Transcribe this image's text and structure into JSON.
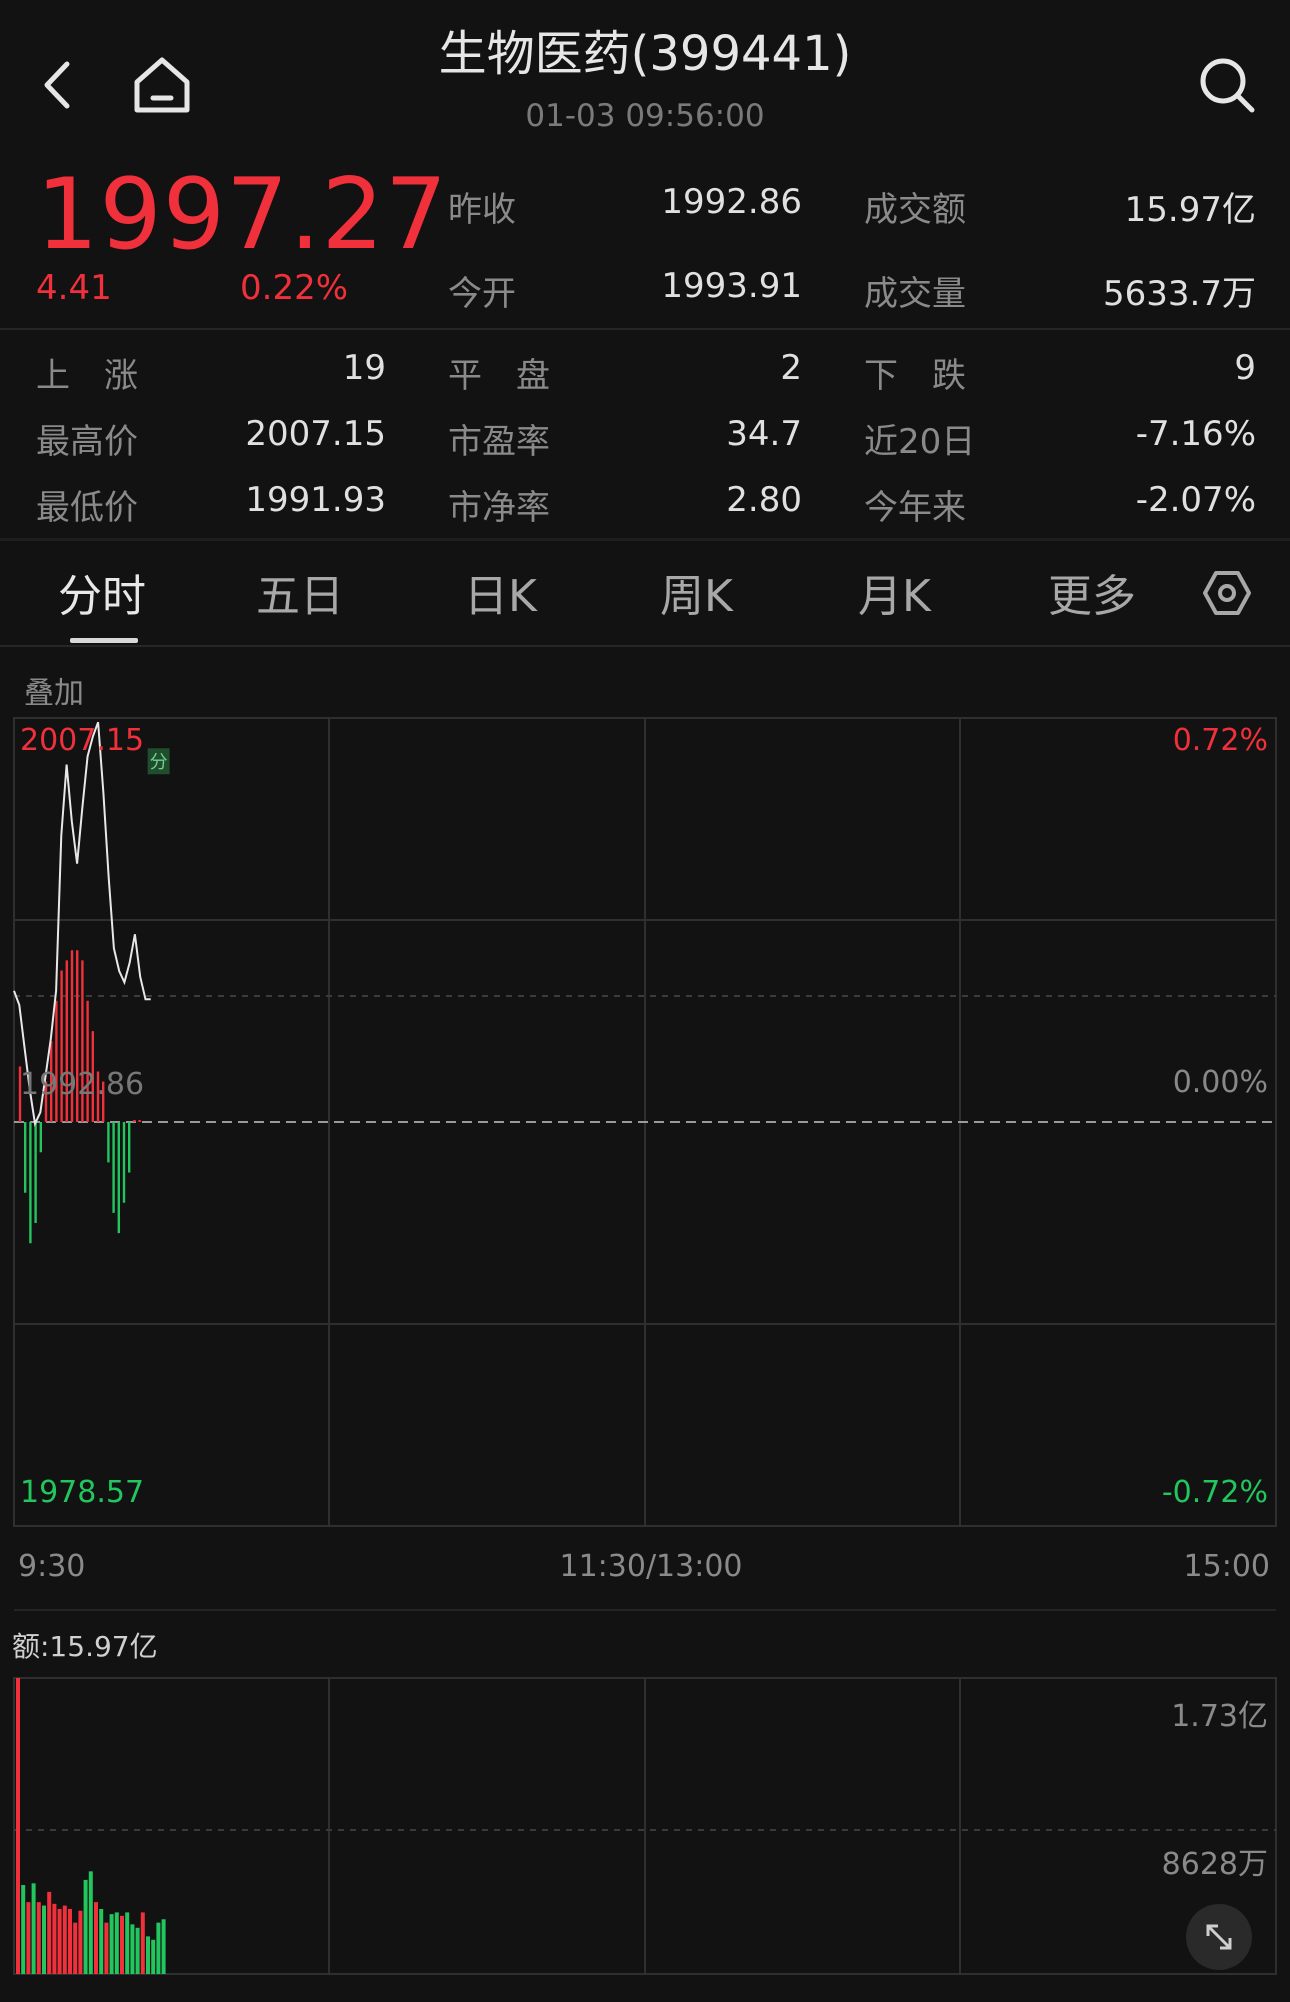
{
  "header": {
    "title": "生物医药(399441)",
    "time": "01-03 09:56:00"
  },
  "quote": {
    "price": "1997.27",
    "change": "4.41",
    "change_pct": "0.22%",
    "prev_close_label": "昨收",
    "prev_close": "1992.86",
    "amount_label": "成交额",
    "amount": "15.97亿",
    "open_label": "今开",
    "open": "1993.91",
    "volume_label": "成交量",
    "volume": "5633.7万"
  },
  "stats": {
    "up_label": "上　涨",
    "up": "19",
    "flat_label": "平　盘",
    "flat": "2",
    "down_label": "下　跌",
    "down": "9",
    "high_label": "最高价",
    "high": "2007.15",
    "pe_label": "市盈率",
    "pe": "34.7",
    "d20_label": "近20日",
    "d20": "-7.16%",
    "low_label": "最低价",
    "low": "1991.93",
    "pb_label": "市净率",
    "pb": "2.80",
    "ytd_label": "今年来",
    "ytd": "-2.07%"
  },
  "tabs": [
    {
      "label": "分时"
    },
    {
      "label": "五日"
    },
    {
      "label": "日K"
    },
    {
      "label": "周K"
    },
    {
      "label": "月K"
    },
    {
      "label": "更多"
    }
  ],
  "overlay_label": "叠加",
  "colors": {
    "up": "#f0303a",
    "down": "#22c55e",
    "line": "#e8e8e8",
    "grid": "#2f2f2f"
  },
  "chart_data": [
    {
      "type": "line",
      "y_left_labels": {
        "top": "2007.15",
        "mid": "1992.86",
        "bottom": "1978.57"
      },
      "y_right_labels": {
        "top": "0.72%",
        "mid": "0.00%",
        "bottom": "-0.72%"
      },
      "x_labels": {
        "start": "9:30",
        "mid": "11:30/13:00",
        "end": "15:00"
      },
      "ylim": [
        1978.57,
        2007.15
      ],
      "base": 1992.86,
      "minutes_total": 240,
      "price_series": [
        1997.5,
        1997.0,
        1995.5,
        1994.0,
        1992.8,
        1993.2,
        1994.5,
        1995.8,
        1997.5,
        2003.0,
        2005.5,
        2003.5,
        2002.0,
        2004.0,
        2005.8,
        2006.5,
        2007.0,
        2004.5,
        2001.5,
        1999.0,
        1998.2,
        1997.8,
        1998.5,
        1999.5,
        1998.0,
        1997.2,
        1997.2
      ],
      "breadth_series": [
        5.5,
        -7,
        -12,
        -10,
        -3,
        4,
        8,
        12,
        15,
        16,
        17,
        17,
        16,
        12,
        9,
        5,
        4,
        -4,
        -9,
        -11,
        -8,
        -5,
        0.2,
        0.2
      ],
      "breadth_ymax": 20,
      "marker": "分"
    },
    {
      "type": "bar",
      "title": "额:15.97亿",
      "y_labels": {
        "top": "1.73亿",
        "mid": "8628万"
      },
      "ylim": [
        0,
        1.73
      ],
      "unit": "亿",
      "values": [
        1.73,
        0.52,
        0.42,
        0.53,
        0.42,
        0.4,
        0.48,
        0.41,
        0.38,
        0.4,
        0.38,
        0.3,
        0.37,
        0.55,
        0.6,
        0.42,
        0.38,
        0.3,
        0.35,
        0.36,
        0.34,
        0.36,
        0.29,
        0.27,
        0.36,
        0.22,
        0.2,
        0.3,
        0.32
      ],
      "directions": [
        "up",
        "down",
        "up",
        "down",
        "up",
        "down",
        "up",
        "up",
        "up",
        "up",
        "up",
        "up",
        "up",
        "down",
        "down",
        "up",
        "down",
        "up",
        "down",
        "down",
        "up",
        "down",
        "down",
        "down",
        "up",
        "down",
        "down",
        "down",
        "down"
      ]
    }
  ]
}
